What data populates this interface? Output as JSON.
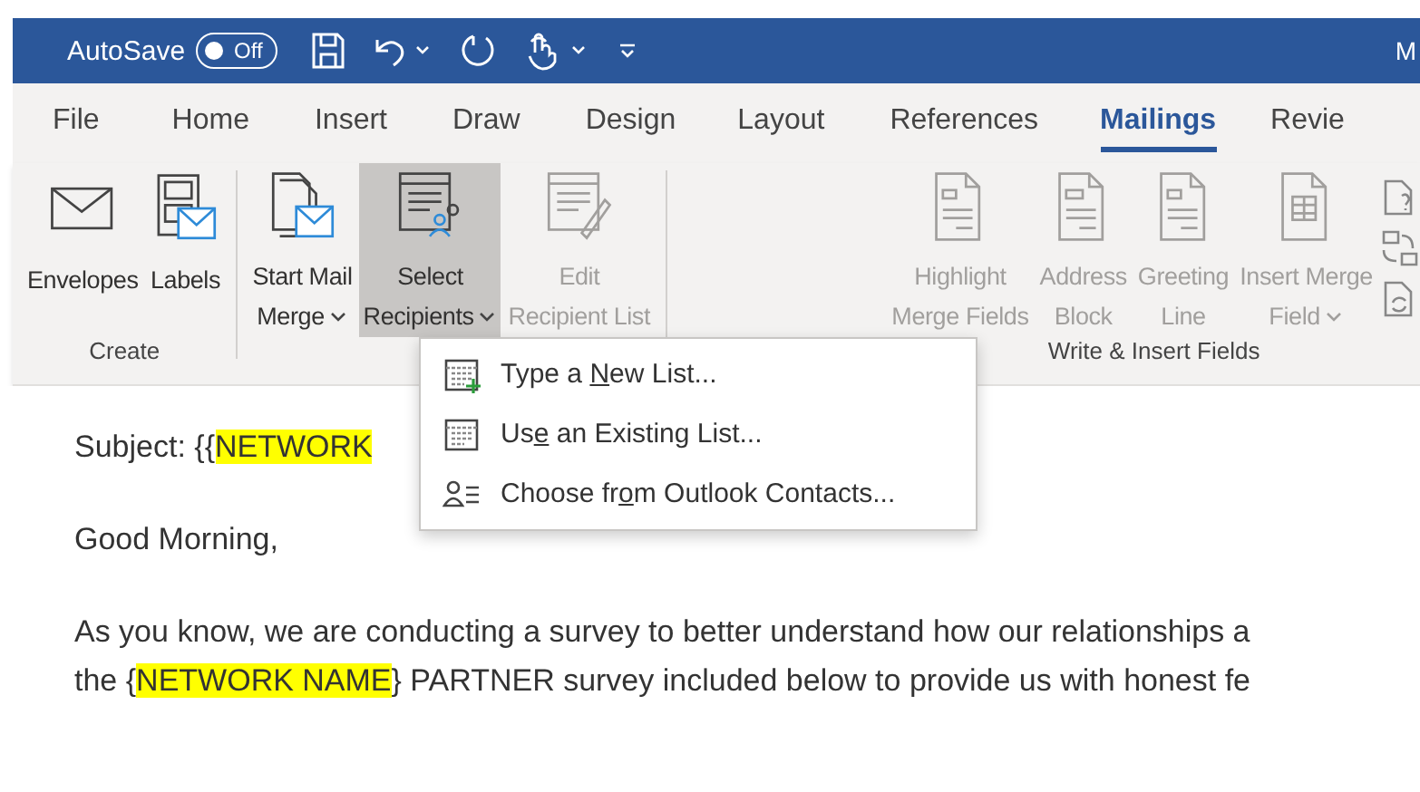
{
  "title_bar": {
    "autosave_label": "AutoSave",
    "autosave": {
      "on": false,
      "label": "Off"
    },
    "account": "M"
  },
  "tabs": [
    {
      "label": "File",
      "selected": false
    },
    {
      "label": "Home",
      "selected": false
    },
    {
      "label": "Insert",
      "selected": false
    },
    {
      "label": "Draw",
      "selected": false
    },
    {
      "label": "Design",
      "selected": false
    },
    {
      "label": "Layout",
      "selected": false
    },
    {
      "label": "References",
      "selected": false
    },
    {
      "label": "Mailings",
      "selected": true
    },
    {
      "label": "Revie",
      "selected": false
    }
  ],
  "ribbon": {
    "groups": [
      {
        "label": "Create",
        "buttons": [
          {
            "lines": [
              "Envelopes"
            ],
            "dropdown": false,
            "pressed": false,
            "disabled": false
          },
          {
            "lines": [
              "Labels"
            ],
            "dropdown": false,
            "pressed": false,
            "disabled": false
          }
        ]
      },
      {
        "buttons": [
          {
            "lines": [
              "Start Mail",
              "Merge"
            ],
            "dropdown": true,
            "pressed": false,
            "disabled": false
          },
          {
            "lines": [
              "Select",
              "Recipients"
            ],
            "dropdown": true,
            "pressed": true,
            "disabled": false
          },
          {
            "lines": [
              "Edit",
              "Recipient List"
            ],
            "dropdown": false,
            "pressed": false,
            "disabled": true
          }
        ]
      },
      {
        "label": "Write & Insert Fields",
        "buttons": [
          {
            "lines": [
              "Highlight",
              "Merge Fields"
            ],
            "dropdown": false,
            "pressed": false,
            "disabled": true
          },
          {
            "lines": [
              "Address",
              "Block"
            ],
            "dropdown": false,
            "pressed": false,
            "disabled": true
          },
          {
            "lines": [
              "Greeting",
              "Line"
            ],
            "dropdown": false,
            "pressed": false,
            "disabled": true
          },
          {
            "lines": [
              "Insert Merge",
              "Field"
            ],
            "dropdown": true,
            "pressed": false,
            "disabled": true
          }
        ]
      }
    ]
  },
  "menu": {
    "items": [
      {
        "before": "Type a ",
        "key": "N",
        "after": "ew List..."
      },
      {
        "before": "Us",
        "key": "e",
        "after": " an Existing List..."
      },
      {
        "before": "Choose fr",
        "key": "o",
        "after": "m Outlook Contacts..."
      }
    ]
  },
  "document": {
    "paragraphs": [
      {
        "runs": [
          {
            "text": "Subject: {{",
            "highlight": false
          },
          {
            "text": "NETWORK",
            "highlight": true
          }
        ]
      },
      {
        "runs": [
          {
            "text": "Good Morning,",
            "highlight": false
          }
        ]
      },
      {
        "lines": [
          {
            "runs": [
              {
                "text": "As you know, we are conducting a survey to better understand how our relationships a",
                "highlight": false
              }
            ]
          },
          {
            "runs": [
              {
                "text": "the {",
                "highlight": false
              },
              {
                "text": "NETWORK NAME",
                "highlight": true
              },
              {
                "text": "} PARTNER survey included below to provide us with honest fe",
                "highlight": false
              }
            ]
          }
        ]
      }
    ]
  }
}
